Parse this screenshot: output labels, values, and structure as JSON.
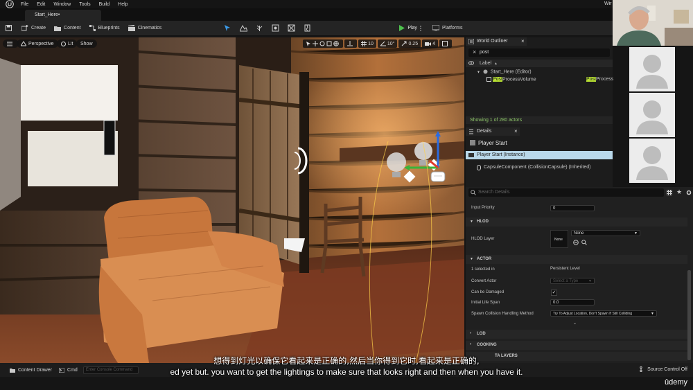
{
  "menu": {
    "items": [
      "File",
      "Edit",
      "Window",
      "Tools",
      "Build",
      "Help"
    ],
    "window_partial": "Wir"
  },
  "tabs": {
    "document": "Start_Here•"
  },
  "toolbar": {
    "create": "Create",
    "content": "Content",
    "blueprints": "Blueprints",
    "cinematics": "Cinematics",
    "play": "Play",
    "platforms": "Platforms"
  },
  "viewport": {
    "perspective": "Perspective",
    "lit": "Lit",
    "show": "Show",
    "grid_snap": "10",
    "rot_snap": "10°",
    "scale_snap": "0.25",
    "cam_speed": "4"
  },
  "outliner": {
    "tab": "World Outliner",
    "search_value": "post",
    "column_label": "Label",
    "level": "Start_Here (Editor)",
    "item_hl": "Post",
    "item_rest": "ProcessVolume",
    "type_hl": "Post",
    "type_rest": "Process",
    "status": "Showing 1 of 280 actors"
  },
  "details": {
    "tab": "Details",
    "actor_name": "Player Start",
    "instance": "Player Start (Instance)",
    "component": "CapsuleComponent (CollisionCapsule) (Inherited)",
    "search_placeholder": "Search Details",
    "input_priority_label": "Input Priority",
    "input_priority_value": "0",
    "hlod_section": "HLOD",
    "hlod_layer_label": "HLOD Layer",
    "hlod_thumb": "None",
    "hlod_value": "None",
    "actor_section": "ACTOR",
    "selected_label": "1 selected in",
    "selected_value": "Persistent Level",
    "convert_label": "Convert Actor",
    "convert_value": "Select a Type",
    "can_damage_label": "Can be Damaged",
    "life_span_label": "Initial Life Span",
    "life_span_value": "0.0",
    "spawn_label": "Spawn Collision Handling Method",
    "spawn_value": "Try To Adjust Location, Don't Spawn If Still Colliding",
    "lod_section": "LOD",
    "cooking_section": "COOKING",
    "data_layers_section": "TA LAYERS"
  },
  "bottom": {
    "content_drawer": "Content Drawer",
    "cmd": "Cmd",
    "console_placeholder": "Enter Console Command",
    "source_control": "Source Control Off"
  },
  "subtitles": {
    "cn": "想得到灯光以确保它看起来是正确的,然后当你得到它时,看起来是正确的,",
    "en": "ed yet but. you want to get the lightings to make sure that looks right and then when you have it."
  },
  "watermark": "ûdemy",
  "colors": {
    "highlight": "#b8e032",
    "selection": "#b9d8ea",
    "play_green": "#4ec24e"
  }
}
